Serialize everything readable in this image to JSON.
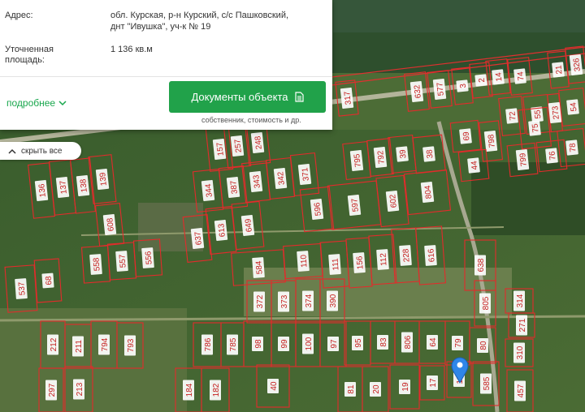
{
  "info": {
    "address_label": "Адрес:",
    "address_value_line1": "обл. Курская, р-н Курский, с/с Пашковский,",
    "address_value_line2": "днт \"Ивушка\", уч-к № 19",
    "area_label_line1": "Уточненная",
    "area_label_line2": "площадь:",
    "area_value": "1 136 кв.м",
    "more_label": "подробнее",
    "docs_button_label": "Документы объекта",
    "docs_subtitle": "собственник, стоимость и др."
  },
  "map": {
    "hide_all_label": "скрыть все",
    "parcels": [
      {
        "label": "18"
      },
      {
        "label": "17"
      },
      {
        "label": "317"
      },
      {
        "label": "326"
      },
      {
        "label": "21"
      },
      {
        "label": "74"
      },
      {
        "label": "2"
      },
      {
        "label": "14"
      },
      {
        "label": "3"
      },
      {
        "label": "577"
      },
      {
        "label": "632"
      },
      {
        "label": "78"
      },
      {
        "label": "54"
      },
      {
        "label": "55"
      },
      {
        "label": "72"
      },
      {
        "label": "273"
      },
      {
        "label": "798"
      },
      {
        "label": "69"
      },
      {
        "label": "75"
      },
      {
        "label": "799"
      },
      {
        "label": "76"
      },
      {
        "label": "44"
      },
      {
        "label": "38"
      },
      {
        "label": "39"
      },
      {
        "label": "792"
      },
      {
        "label": "795"
      },
      {
        "label": "371"
      },
      {
        "label": "342"
      },
      {
        "label": "343"
      },
      {
        "label": "387"
      },
      {
        "label": "344"
      },
      {
        "label": "157"
      },
      {
        "label": "257"
      },
      {
        "label": "248"
      },
      {
        "label": "804"
      },
      {
        "label": "602"
      },
      {
        "label": "597"
      },
      {
        "label": "596"
      },
      {
        "label": "649"
      },
      {
        "label": "613"
      },
      {
        "label": "637"
      },
      {
        "label": "136"
      },
      {
        "label": "137"
      },
      {
        "label": "138"
      },
      {
        "label": "139"
      },
      {
        "label": "608"
      },
      {
        "label": "616"
      },
      {
        "label": "228"
      },
      {
        "label": "112"
      },
      {
        "label": "156"
      },
      {
        "label": "111"
      },
      {
        "label": "110"
      },
      {
        "label": "584"
      },
      {
        "label": "556"
      },
      {
        "label": "557"
      },
      {
        "label": "558"
      },
      {
        "label": "68"
      },
      {
        "label": "537"
      },
      {
        "label": "638"
      },
      {
        "label": "805"
      },
      {
        "label": "390"
      },
      {
        "label": "374"
      },
      {
        "label": "373"
      },
      {
        "label": "372"
      },
      {
        "label": "314"
      },
      {
        "label": "271"
      },
      {
        "label": "310"
      },
      {
        "label": "212"
      },
      {
        "label": "211"
      },
      {
        "label": "794"
      },
      {
        "label": "793"
      },
      {
        "label": "786"
      },
      {
        "label": "785"
      },
      {
        "label": "98"
      },
      {
        "label": "99"
      },
      {
        "label": "100"
      },
      {
        "label": "97"
      },
      {
        "label": "95"
      },
      {
        "label": "83"
      },
      {
        "label": "806"
      },
      {
        "label": "64"
      },
      {
        "label": "79"
      },
      {
        "label": "80"
      },
      {
        "label": "297"
      },
      {
        "label": "213"
      },
      {
        "label": "184"
      },
      {
        "label": "182"
      },
      {
        "label": "40"
      },
      {
        "label": "81"
      },
      {
        "label": "20"
      },
      {
        "label": "19"
      },
      {
        "label": "585"
      },
      {
        "label": "457"
      }
    ]
  }
}
